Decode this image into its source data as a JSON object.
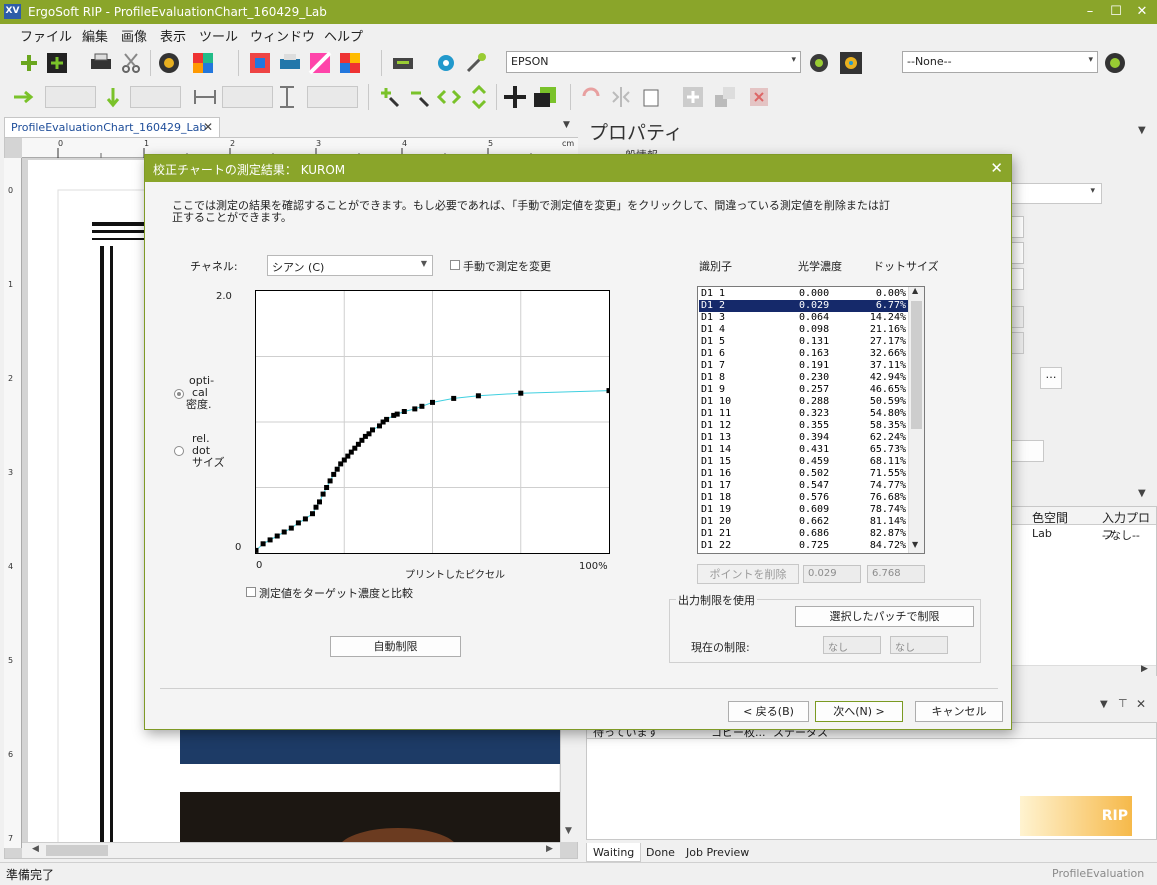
{
  "app": {
    "title": "ErgoSoft RIP - ProfileEvaluationChart_160429_Lab",
    "logo_text": "XV",
    "window_controls": [
      "–",
      "☐",
      "✕"
    ]
  },
  "menu": [
    "ファイル",
    "編集",
    "画像",
    "表示",
    "ツール",
    "ウィンドウ",
    "ヘルプ"
  ],
  "toolbar": {
    "printer": "EPSON",
    "preset": "--None--"
  },
  "document": {
    "tab_label": "ProfileEvaluationChart_160429_Lab",
    "ruler_top": [
      "0",
      "1",
      "2",
      "3",
      "4",
      "5",
      "cm"
    ],
    "ruler_left": [
      "0",
      "1",
      "2",
      "3",
      "4",
      "5",
      "6",
      "7"
    ]
  },
  "properties": {
    "title": "プロパティ",
    "subtitle": "一般情報"
  },
  "queue": {
    "col_color_space": "色空間",
    "col_input_profile": "入力プロフ",
    "row_color_space": "Lab",
    "row_input_profile": "--なし--"
  },
  "jobs": {
    "col1": "待っています",
    "col2": "コピー枚...",
    "col3": "ステータス",
    "tabs": [
      "Waiting",
      "Done",
      "Job Preview"
    ],
    "logo": "RIP"
  },
  "status": {
    "left": "準備完了",
    "right": "ProfileEvaluation"
  },
  "dialog": {
    "title": "校正チャートの測定結果： KUROM",
    "description": "ここでは測定の結果を確認することができます。もし必要であれば、「手動で測定値を変更」をクリックして、間違っている測定値を削除または訂正することができます。",
    "channel_label": "チャネル:",
    "channel_value": "シアン (C)",
    "manual_edit": "手動で測定を変更",
    "radio_optical": [
      "opti-",
      "cal",
      "密度."
    ],
    "radio_dot": [
      "rel.",
      "dot",
      "サイズ"
    ],
    "y_top": "2.0",
    "y_bottom": "0",
    "x_left": "0",
    "x_label": "プリントしたピクセル",
    "x_right": "100%",
    "compare_target": "測定値をターゲット濃度と比較",
    "auto_limit": "自動制限",
    "list_header": [
      "識別子",
      "光学濃度",
      "ドットサイズ"
    ],
    "rows": [
      [
        "D1 1",
        "0.000",
        "0.00%"
      ],
      [
        "D1 2",
        "0.029",
        "6.77%"
      ],
      [
        "D1 3",
        "0.064",
        "14.24%"
      ],
      [
        "D1 4",
        "0.098",
        "21.16%"
      ],
      [
        "D1 5",
        "0.131",
        "27.17%"
      ],
      [
        "D1 6",
        "0.163",
        "32.66%"
      ],
      [
        "D1 7",
        "0.191",
        "37.11%"
      ],
      [
        "D1 8",
        "0.230",
        "42.94%"
      ],
      [
        "D1 9",
        "0.257",
        "46.65%"
      ],
      [
        "D1 10",
        "0.288",
        "50.59%"
      ],
      [
        "D1 11",
        "0.323",
        "54.80%"
      ],
      [
        "D1 12",
        "0.355",
        "58.35%"
      ],
      [
        "D1 13",
        "0.394",
        "62.24%"
      ],
      [
        "D1 14",
        "0.431",
        "65.73%"
      ],
      [
        "D1 15",
        "0.459",
        "68.11%"
      ],
      [
        "D1 16",
        "0.502",
        "71.55%"
      ],
      [
        "D1 17",
        "0.547",
        "74.77%"
      ],
      [
        "D1 18",
        "0.576",
        "76.68%"
      ],
      [
        "D1 19",
        "0.609",
        "78.74%"
      ],
      [
        "D1 20",
        "0.662",
        "81.14%"
      ],
      [
        "D1 21",
        "0.686",
        "82.87%"
      ],
      [
        "D1 22",
        "0.725",
        "84.72%"
      ]
    ],
    "selected_row": 1,
    "delete_point": "ポイントを削除",
    "sel_density": "0.029",
    "sel_dot": "6.768",
    "limit_group": "出力制限を使用",
    "limit_button": "選択したパッチで制限",
    "current_limit": "現在の制限:",
    "limit_values": [
      "なし",
      "なし"
    ],
    "back": "< 戻る(B)",
    "next": "次へ(N) >",
    "cancel": "キャンセル"
  },
  "chart_data": {
    "type": "scatter",
    "x_label": "プリントしたピクセル",
    "xlim": [
      0,
      100
    ],
    "ylim": [
      0,
      2.0
    ],
    "grid": true,
    "series_color": "#40d0e0",
    "x": [
      0,
      2,
      4,
      6,
      8,
      10,
      12,
      14,
      16,
      17,
      18,
      19,
      20,
      21,
      22,
      23,
      24,
      25,
      26,
      27,
      28,
      29,
      30,
      31,
      32,
      33,
      35,
      36,
      37,
      39,
      40,
      42,
      45,
      47,
      50,
      56,
      63,
      75,
      100
    ],
    "y": [
      0.02,
      0.07,
      0.1,
      0.13,
      0.16,
      0.19,
      0.23,
      0.26,
      0.3,
      0.35,
      0.39,
      0.45,
      0.5,
      0.55,
      0.6,
      0.64,
      0.68,
      0.71,
      0.74,
      0.77,
      0.8,
      0.83,
      0.86,
      0.89,
      0.91,
      0.94,
      0.97,
      1.0,
      1.02,
      1.05,
      1.06,
      1.08,
      1.1,
      1.12,
      1.15,
      1.18,
      1.2,
      1.22,
      1.24
    ]
  }
}
